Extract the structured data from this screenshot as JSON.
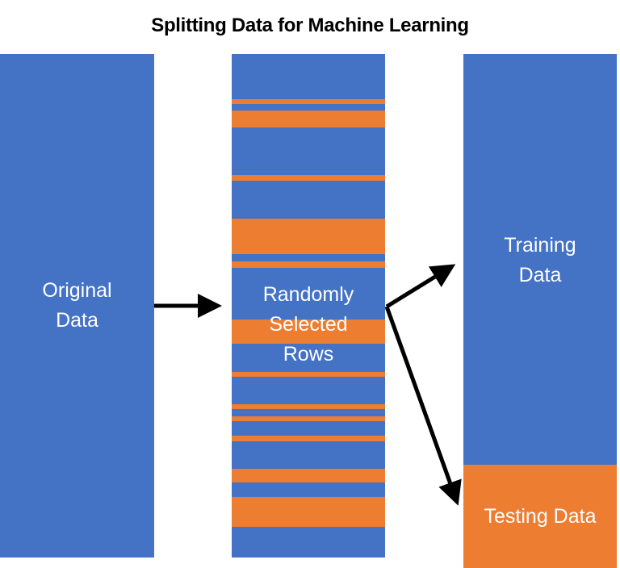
{
  "title": "Splitting Data for Machine Learning",
  "colors": {
    "blue": "#4472C4",
    "orange": "#ED7D31",
    "arrow": "#000000",
    "text_on_box": "#FFFFFF"
  },
  "boxes": {
    "original": {
      "lines": [
        "Original",
        "Data"
      ]
    },
    "random": {
      "lines": [
        "Randomly",
        "Selected",
        "Rows"
      ],
      "selected_row_stripes_fraction": [
        [
          0.09,
          0.099
        ],
        [
          0.112,
          0.146
        ],
        [
          0.24,
          0.252
        ],
        [
          0.327,
          0.397
        ],
        [
          0.412,
          0.425
        ],
        [
          0.527,
          0.575
        ],
        [
          0.631,
          0.641
        ],
        [
          0.696,
          0.705
        ],
        [
          0.72,
          0.729
        ],
        [
          0.758,
          0.769
        ],
        [
          0.824,
          0.851
        ],
        [
          0.88,
          0.939
        ]
      ]
    },
    "training": {
      "lines": [
        "Training",
        "Data"
      ]
    },
    "testing": {
      "lines": [
        "Testing Data"
      ]
    }
  },
  "arrows": [
    {
      "from": "original",
      "to": "random"
    },
    {
      "from": "random",
      "to": "training"
    },
    {
      "from": "random",
      "to": "testing"
    }
  ]
}
